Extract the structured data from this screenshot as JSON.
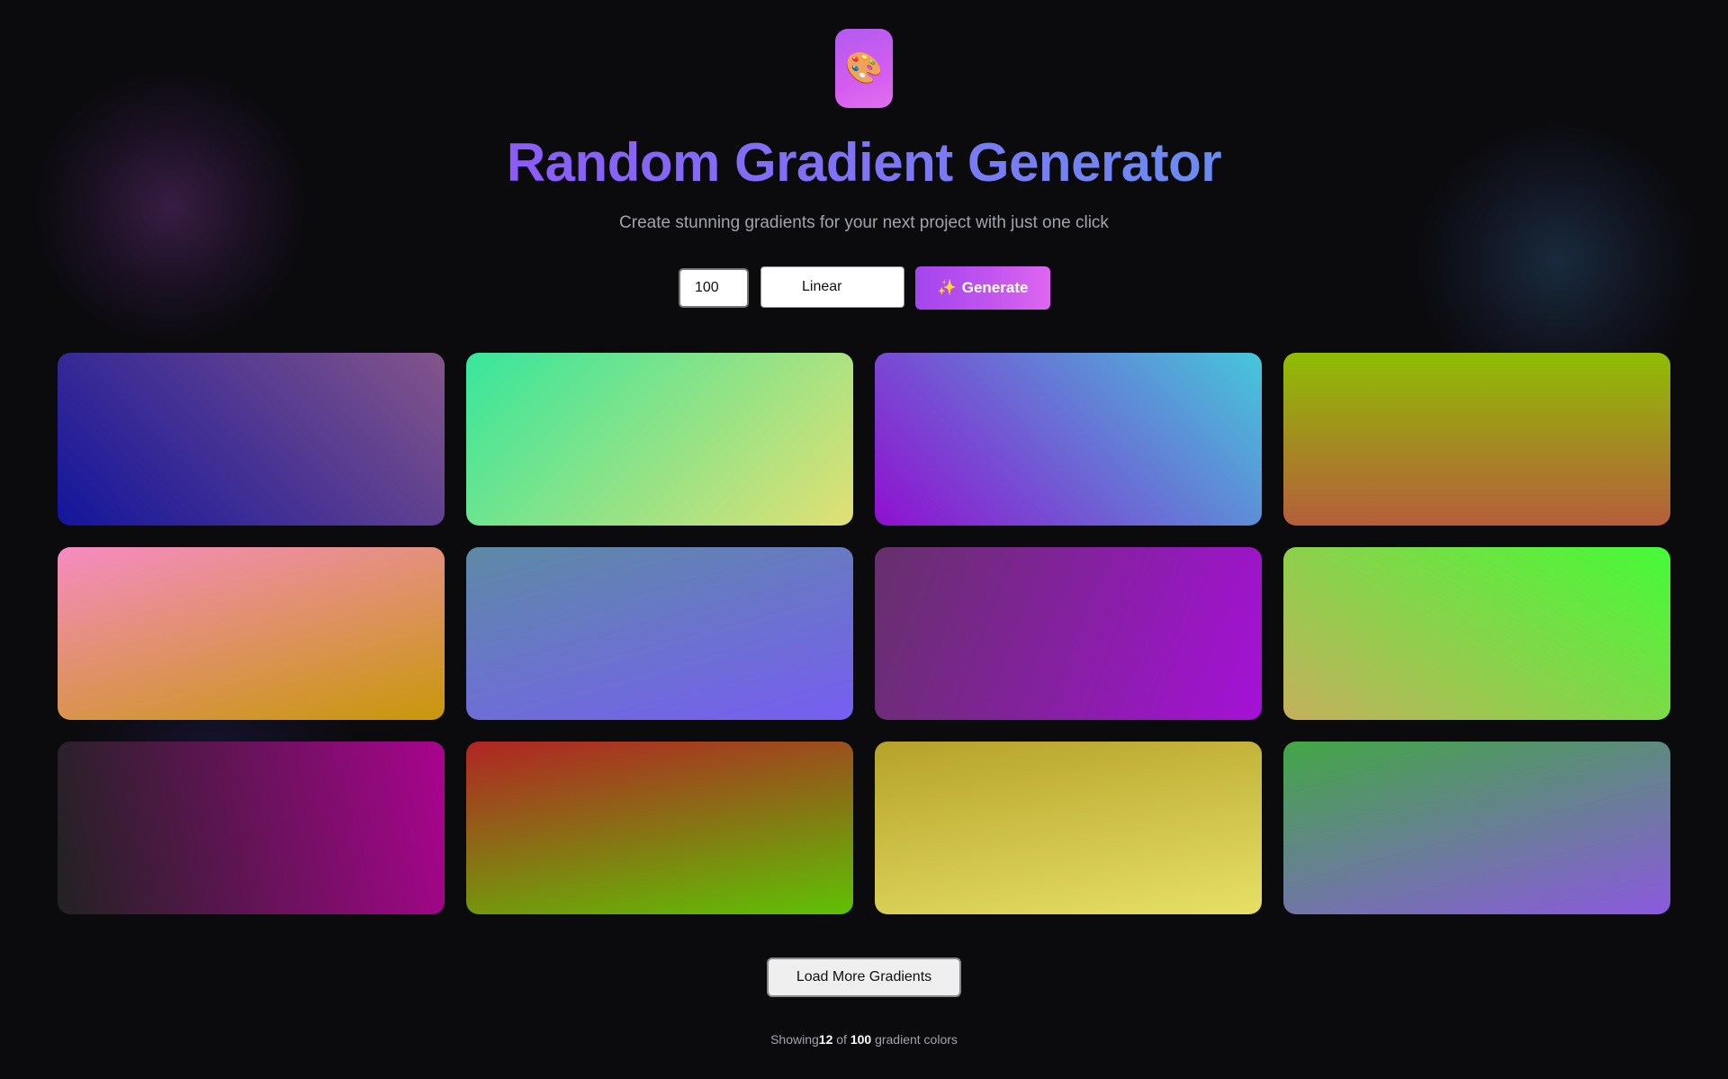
{
  "header": {
    "logo_icon": "🎨",
    "logo_icon_name": "palette-icon",
    "title": "Random Gradient Generator",
    "subtitle": "Create stunning gradients for your next project with just one click"
  },
  "controls": {
    "count_value": "100",
    "gradient_type": "Linear",
    "generate_icon": "✨",
    "generate_label": "Generate"
  },
  "gradients": [
    {
      "type": "linear",
      "angle": 45,
      "colors": [
        "#13159c",
        "#83558a"
      ]
    },
    {
      "type": "linear",
      "angle": 135,
      "colors": [
        "#37e69c",
        "#e2e074"
      ]
    },
    {
      "type": "linear",
      "angle": 45,
      "colors": [
        "#9010d0",
        "#46c7da"
      ]
    },
    {
      "type": "linear",
      "angle": 0,
      "colors": [
        "#b65e3b",
        "#8fbd04"
      ]
    },
    {
      "type": "linear",
      "angle": 165,
      "colors": [
        "#f68bc2",
        "#c89808"
      ]
    },
    {
      "type": "linear",
      "angle": 165,
      "colors": [
        "#5d8aa5",
        "#775ef2"
      ]
    },
    {
      "type": "linear",
      "angle": 110,
      "colors": [
        "#65306a",
        "#a511d7"
      ]
    },
    {
      "type": "linear",
      "angle": 30,
      "colors": [
        "#c5b05d",
        "#44fb36"
      ]
    },
    {
      "type": "linear",
      "angle": 80,
      "colors": [
        "#222222",
        "#a9048e"
      ]
    },
    {
      "type": "linear",
      "angle": 170,
      "colors": [
        "#b12424",
        "#5fc105"
      ]
    },
    {
      "type": "linear",
      "angle": 170,
      "colors": [
        "#b6a22a",
        "#e6e067"
      ]
    },
    {
      "type": "linear",
      "angle": 165,
      "colors": [
        "#42a745",
        "#8c59e0"
      ]
    }
  ],
  "load_more": {
    "label": "Load More Gradients"
  },
  "footer": {
    "prefix": "Showing",
    "shown": "12",
    "middle": " of ",
    "total": "100",
    "suffix": " gradient colors"
  }
}
